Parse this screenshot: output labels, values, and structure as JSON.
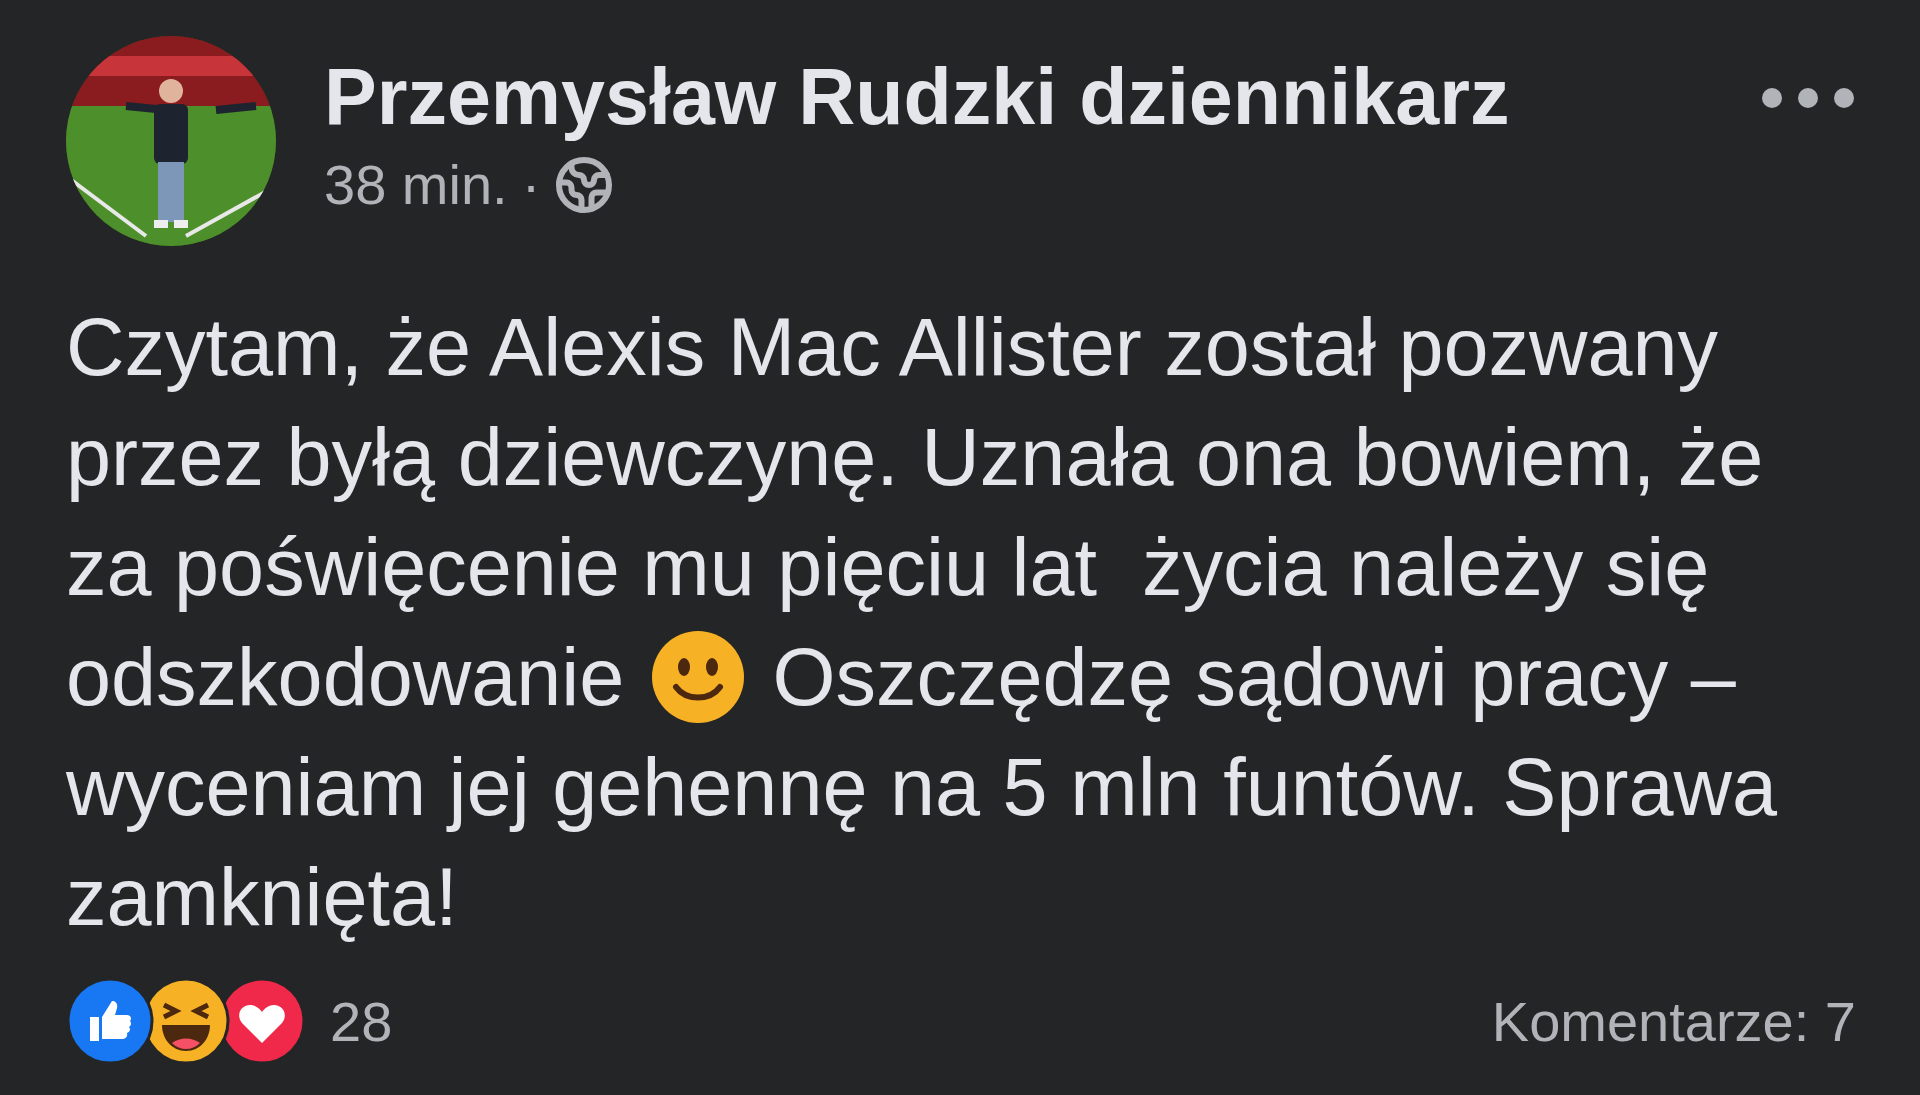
{
  "post": {
    "author": "Przemysław Rudzki dziennikarz",
    "time": "38 min.",
    "separator": "·",
    "lines": [
      [
        {
          "kind": "text",
          "text": "Czytam, że Alexis Mac Allister został pozwany"
        }
      ],
      [
        {
          "kind": "text",
          "text": "przez byłą dziewczynę. Uznała ona bowiem, że"
        }
      ],
      [
        {
          "kind": "text",
          "text": "za poświęcenie mu pięciu lat  życia należy się"
        }
      ],
      [
        {
          "kind": "text",
          "text": "odszkodowanie"
        },
        {
          "kind": "emoji"
        },
        {
          "kind": "text",
          "text": "Oszczędzę sądowi pracy –"
        }
      ],
      [
        {
          "kind": "text",
          "text": "wyceniam jej gehennę na 5 mln funtów. Sprawa"
        }
      ],
      [
        {
          "kind": "text",
          "text": "zamknięta!"
        }
      ]
    ],
    "reactions": {
      "icons": [
        {
          "kind": "like"
        },
        {
          "kind": "haha"
        },
        {
          "kind": "love"
        }
      ],
      "count": "28"
    },
    "comments": "Komentarze: 7"
  }
}
